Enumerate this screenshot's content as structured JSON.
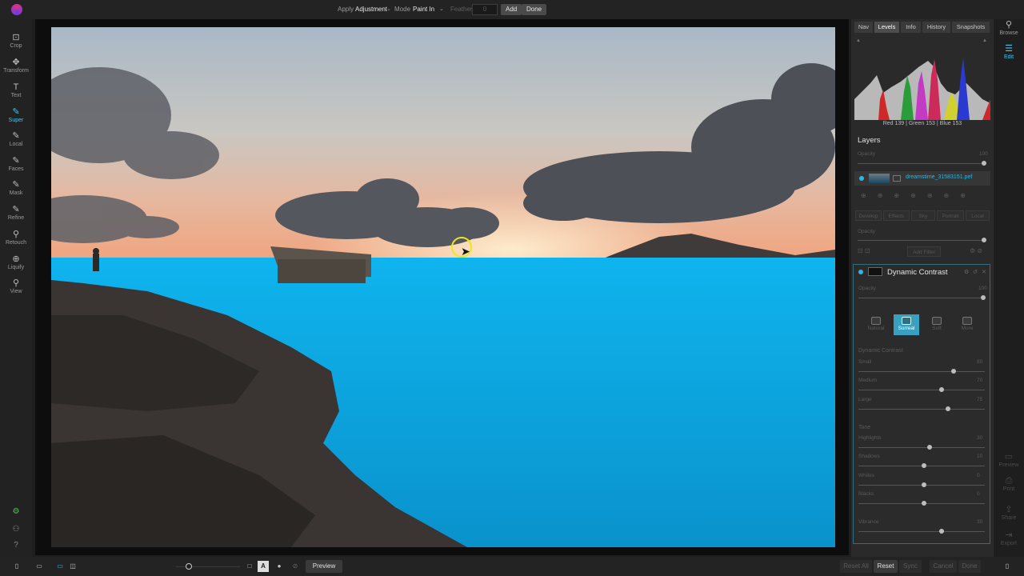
{
  "topbar": {
    "apply_label": "Apply",
    "apply_value": "Adjustment",
    "mode_label": "Mode",
    "mode_value": "Paint In",
    "feather_label": "Feather",
    "feather_value": "0",
    "add_button": "Add",
    "done_button": "Done"
  },
  "left_tools": [
    {
      "label": "Crop",
      "icon": "crop-icon"
    },
    {
      "label": "Transform",
      "icon": "transform-icon"
    },
    {
      "label": "Text",
      "icon": "text-icon"
    },
    {
      "label": "Super",
      "icon": "super-brush-icon",
      "active": true
    },
    {
      "label": "Local",
      "icon": "local-brush-icon"
    },
    {
      "label": "Faces",
      "icon": "faces-icon"
    },
    {
      "label": "Mask",
      "icon": "mask-icon"
    },
    {
      "label": "Refine",
      "icon": "refine-icon"
    },
    {
      "label": "Retouch",
      "icon": "retouch-icon"
    },
    {
      "label": "Liquify",
      "icon": "liquify-icon"
    },
    {
      "label": "View",
      "icon": "view-icon"
    }
  ],
  "right_tabs": [
    "Nav",
    "Levels",
    "Info",
    "History",
    "Snapshots"
  ],
  "right_tab_selected": "Levels",
  "histogram_readout": "Red 139 | Green 153 | Blue 153",
  "layers": {
    "title": "Layers",
    "opacity_label": "Opacity",
    "opacity_value": "100",
    "layer_name": "dreamstime_31583151.pef",
    "filter_tabs": [
      "Develop",
      "Effects",
      "Sky",
      "Portrait",
      "Local"
    ],
    "add_filter": "Add Filter"
  },
  "filter_panel": {
    "title": "Dynamic Contrast",
    "opacity_label": "Opacity",
    "opacity_value": "100",
    "presets": [
      "Natural",
      "Surreal",
      "Soft",
      "More"
    ],
    "preset_selected": "Surreal",
    "section1_title": "Dynamic Contrast",
    "section1_sliders": [
      {
        "label": "Small",
        "value": "80"
      },
      {
        "label": "Medium",
        "value": "70"
      },
      {
        "label": "Large",
        "value": "75"
      }
    ],
    "section2_title": "Tone",
    "section2_sliders": [
      {
        "label": "Highlights",
        "value": "30"
      },
      {
        "label": "Shadows",
        "value": "10"
      },
      {
        "label": "Whites",
        "value": "0"
      },
      {
        "label": "Blacks",
        "value": "0"
      },
      {
        "label": "Vibrance",
        "value": "30"
      }
    ]
  },
  "far_right": {
    "browse": "Browse",
    "edit": "Edit",
    "preview": "Preview",
    "print": "Print",
    "share": "Share",
    "export": "Export"
  },
  "bottombar": {
    "preview_button": "Preview",
    "reset_all": "Reset All",
    "reset": "Reset",
    "sync": "Sync",
    "cancel": "Cancel",
    "done": "Done"
  },
  "colors": {
    "accent": "#3fc4f0",
    "mask_overlay": "#0aa7e0",
    "brush_ring": "#e8e820"
  }
}
